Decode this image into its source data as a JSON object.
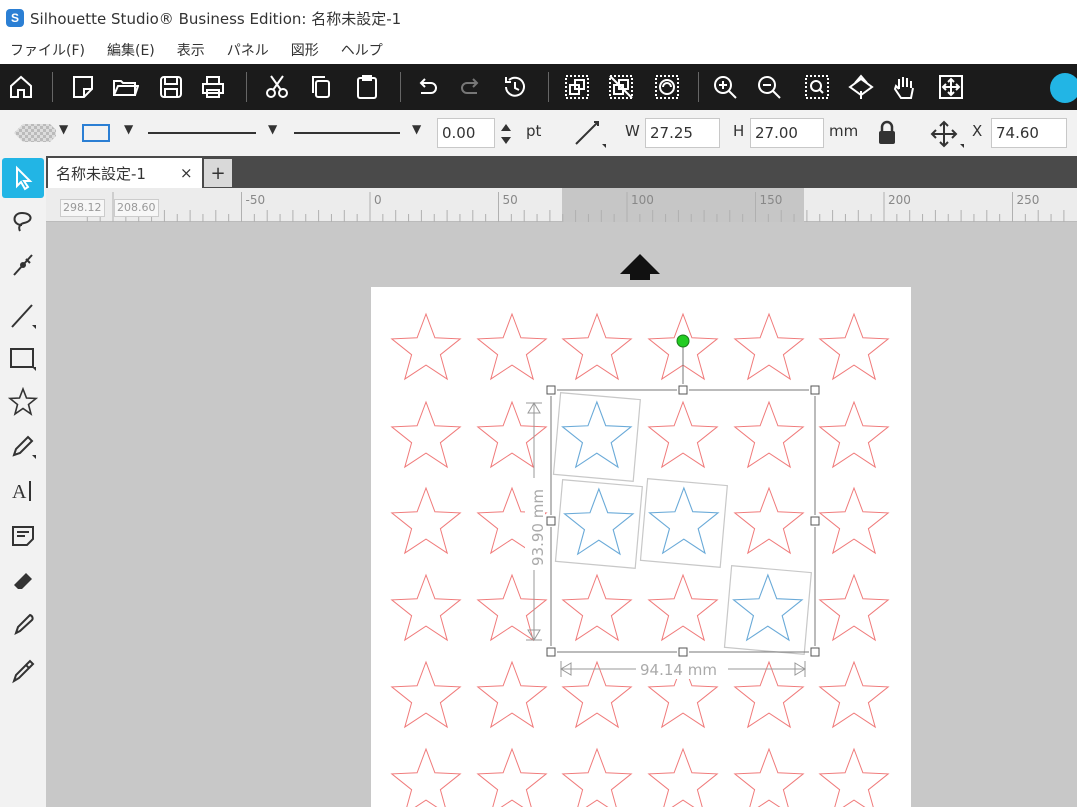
{
  "window": {
    "title": "Silhouette Studio® Business Edition: 名称未設定-1",
    "app_icon_glyph": "S"
  },
  "menu": {
    "items": [
      "ファイル(F)",
      "編集(E)",
      "表示",
      "パネル",
      "図形",
      "ヘルプ"
    ]
  },
  "toolbar": {
    "icons": [
      "home-icon",
      "new-page-icon",
      "open-folder-icon",
      "save-icon",
      "print-icon",
      "cut-icon",
      "copy-icon",
      "paste-icon",
      "undo-icon",
      "redo-icon",
      "history-icon",
      "group-icon",
      "ungroup-icon",
      "compound-icon",
      "zoom-in-icon",
      "zoom-out-icon",
      "zoom-selection-icon",
      "move-page-icon",
      "pan-hand-icon",
      "fit-page-icon"
    ],
    "accent_color": "#22b5e5"
  },
  "properties": {
    "line_width_value": "0.00",
    "line_width_unit": "pt",
    "width_label": "W",
    "width_value": "27.25",
    "height_label": "H",
    "height_value": "27.00",
    "size_unit": "mm",
    "x_label": "X",
    "x_value": "74.60"
  },
  "tabs": {
    "active_label": "名称未設定-1",
    "close_glyph": "×",
    "add_glyph": "+"
  },
  "ruler": {
    "cursor_x": "298.12",
    "cursor_y": "208.60",
    "ticks": [
      "-50",
      "0",
      "50",
      "100",
      "150",
      "200",
      "250"
    ]
  },
  "canvas": {
    "selection_height": "93.90 mm",
    "selection_width": "94.14 mm",
    "star_color_unselected": "#f07a7a",
    "star_color_selected": "#6aaad8",
    "handle_rotate_color": "#22cc22"
  }
}
